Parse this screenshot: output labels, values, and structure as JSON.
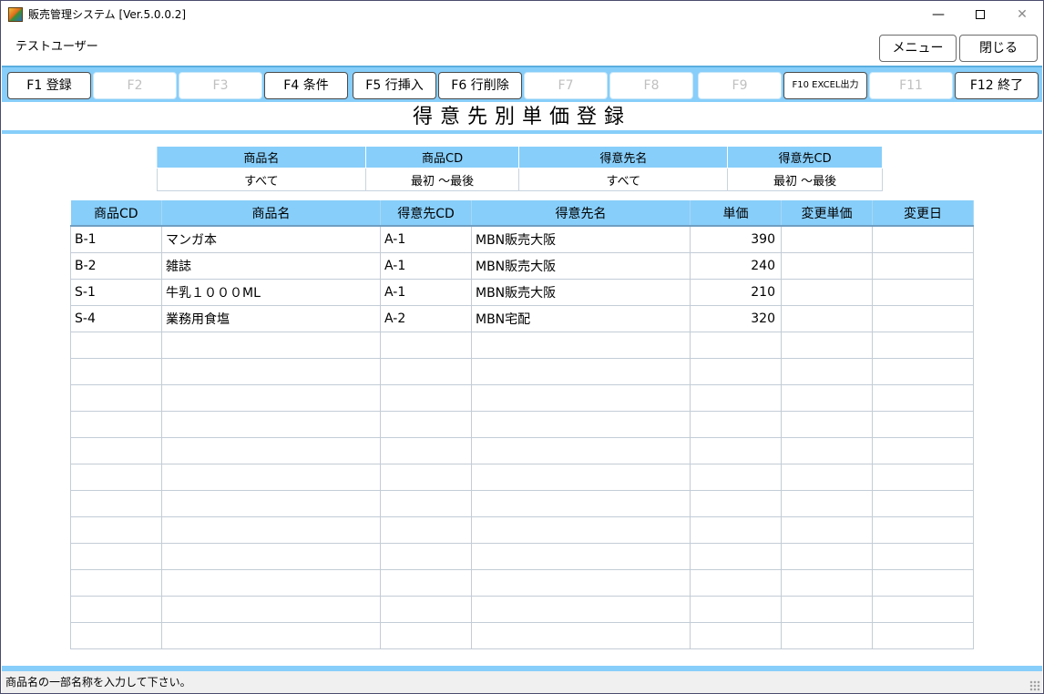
{
  "window": {
    "title": "販売管理システム [Ver.5.0.0.2]",
    "minimize": "—",
    "close": "✕"
  },
  "header": {
    "user": "テストユーザー",
    "menu_label": "メニュー",
    "close_label": "閉じる"
  },
  "fkeys": [
    {
      "label": "F1 登録",
      "enabled": true
    },
    {
      "label": "F2",
      "enabled": false
    },
    {
      "label": "F3",
      "enabled": false
    },
    {
      "label": "F4 条件",
      "enabled": true
    },
    {
      "label": "F5 行挿入",
      "enabled": true
    },
    {
      "label": "F6 行削除",
      "enabled": true
    },
    {
      "label": "F7",
      "enabled": false
    },
    {
      "label": "F8",
      "enabled": false
    },
    {
      "label": "F9",
      "enabled": false
    },
    {
      "label": "F10 EXCEL出力",
      "enabled": true
    },
    {
      "label": "F11",
      "enabled": false
    },
    {
      "label": "F12 終了",
      "enabled": true
    }
  ],
  "screen_title": "得意先別単価登録",
  "conditions": {
    "headers": [
      "商品名",
      "商品CD",
      "得意先名",
      "得意先CD"
    ],
    "values": [
      "すべて",
      "最初 ～最後",
      "すべて",
      "最初 ～最後"
    ]
  },
  "grid": {
    "headers": [
      "商品CD",
      "商品名",
      "得意先CD",
      "得意先名",
      "単価",
      "変更単価",
      "変更日"
    ],
    "rows": [
      [
        "B-1",
        "マンガ本",
        "A-1",
        "MBN販売大阪",
        "390",
        "",
        ""
      ],
      [
        "B-2",
        "雑誌",
        "A-1",
        "MBN販売大阪",
        "240",
        "",
        ""
      ],
      [
        "S-1",
        "牛乳１０００ML",
        "A-1",
        "MBN販売大阪",
        "210",
        "",
        ""
      ],
      [
        "S-4",
        "業務用食塩",
        "A-2",
        "MBN宅配",
        "320",
        "",
        ""
      ]
    ],
    "empty_rows": 12
  },
  "status": {
    "message": "商品名の一部名称を入力して下さい。"
  }
}
